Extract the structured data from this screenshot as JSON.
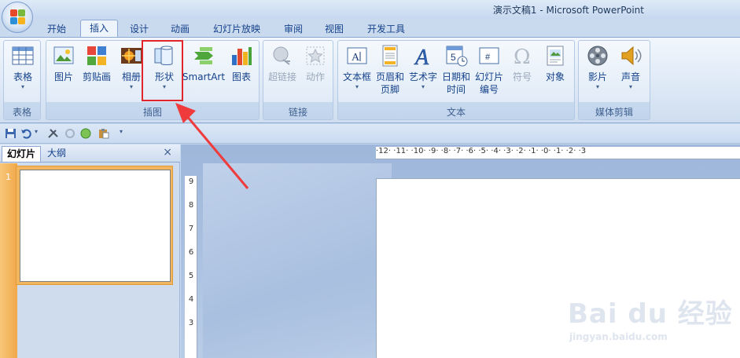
{
  "window": {
    "title": "演示文稿1 - Microsoft PowerPoint"
  },
  "tabs": [
    {
      "label": "开始"
    },
    {
      "label": "插入"
    },
    {
      "label": "设计"
    },
    {
      "label": "动画"
    },
    {
      "label": "幻灯片放映"
    },
    {
      "label": "审阅"
    },
    {
      "label": "视图"
    },
    {
      "label": "开发工具"
    }
  ],
  "ribbon": {
    "groups": {
      "table": {
        "label": "表格",
        "table_btn": "表格"
      },
      "illustrations": {
        "label": "插图",
        "picture": "图片",
        "clipart": "剪贴画",
        "album": "相册",
        "shapes": "形状",
        "smartart": "SmartArt",
        "chart": "图表"
      },
      "links": {
        "label": "链接",
        "hyperlink": "超链接",
        "action": "动作"
      },
      "text": {
        "label": "文本",
        "textbox": "文本框",
        "header_line1": "页眉和",
        "header_line2": "页脚",
        "wordart": "艺术字",
        "datetime_line1": "日期和",
        "datetime_line2": "时间",
        "slidenum_line1": "幻灯片",
        "slidenum_line2": "编号",
        "symbol": "符号",
        "object": "对象"
      },
      "media": {
        "label": "媒体剪辑",
        "movie": "影片",
        "sound": "声音"
      }
    }
  },
  "pane": {
    "tab_slides": "幻灯片",
    "tab_outline": "大纲",
    "close": "×",
    "slide_number": "1"
  },
  "ruler": {
    "horizontal": "·12·  ·11·  ·10·  ·9·  ·8·  ·7·  ·6·  ·5·  ·4·  ·3·  ·2·  ·1·  ·0·  ·1·  ·2·  ·3",
    "vertical": [
      "9",
      "8",
      "7",
      "6",
      "5",
      "4",
      "3"
    ]
  },
  "watermark": {
    "main": "Bai du 经验",
    "sub": "jingyan.baidu.com"
  },
  "colors": {
    "highlight": "#e2252c",
    "tab_text": "#15428b",
    "thumb_select": "#f2b65f"
  }
}
